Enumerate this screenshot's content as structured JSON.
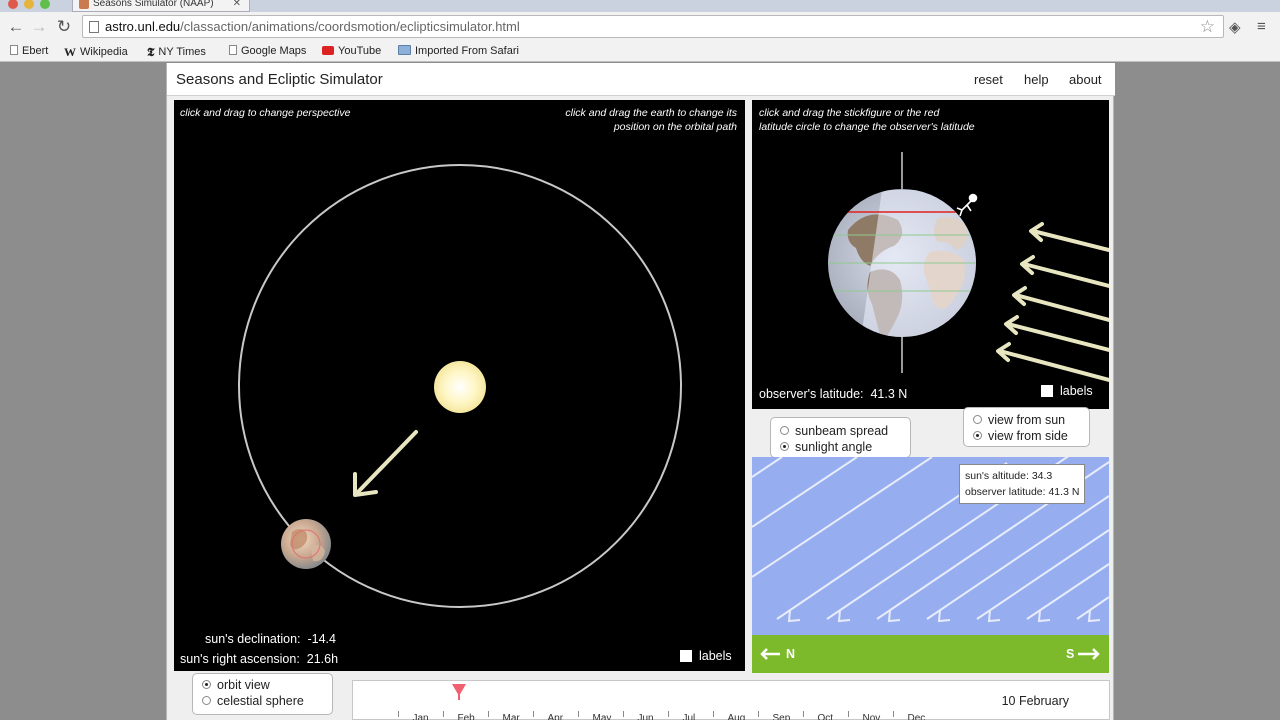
{
  "browser": {
    "tab_title": "Seasons Simulator (NAAP)",
    "url_host": "astro.unl.edu",
    "url_path": "/classaction/animations/coordsmotion/eclipticsimulator.html",
    "bookmarks": [
      {
        "label": "Ebert",
        "icon": "page-icon"
      },
      {
        "label": "Wikipedia",
        "icon": "wikipedia-icon"
      },
      {
        "label": "NY Times",
        "icon": "nytimes-icon"
      },
      {
        "label": "Google Maps",
        "icon": "page-icon"
      },
      {
        "label": "YouTube",
        "icon": "youtube-icon"
      },
      {
        "label": "Imported From Safari",
        "icon": "folder-icon"
      }
    ]
  },
  "sim": {
    "title": "Seasons and Ecliptic Simulator",
    "menu": {
      "reset": "reset",
      "help": "help",
      "about": "about"
    },
    "orbit_panel": {
      "hint_left": "click and drag to change perspective",
      "hint_right_1": "click and drag the earth to change its",
      "hint_right_2": "position on the orbital path",
      "declination_label": "sun's declination:",
      "declination_value": "-14.4",
      "ra_label": "sun's right ascension:",
      "ra_value": "21.6h",
      "labels_checkbox": "labels"
    },
    "earth_panel": {
      "hint_1": "click and drag the stickfigure or the red",
      "hint_2": "latitude circle to change the observer's latitude",
      "latitude_label": "observer's latitude:",
      "latitude_value": "41.3 N",
      "labels_checkbox": "labels"
    },
    "beam_options": {
      "spread": "sunbeam spread",
      "angle": "sunlight angle",
      "selected": "sunlight angle"
    },
    "view_options": {
      "from_sun": "view from sun",
      "from_side": "view from side",
      "selected": "view from side"
    },
    "sunlight_panel": {
      "altitude_label": "sun's altitude:",
      "altitude_value": "34.3",
      "observer_label": "observer latitude:",
      "observer_value": "41.3 N",
      "north": "N",
      "south": "S"
    },
    "view_mode": {
      "orbit": "orbit view",
      "celestial": "celestial sphere",
      "selected": "orbit view"
    },
    "timeline": {
      "date": "10 February",
      "months": [
        "Jan",
        "Feb",
        "Mar",
        "Apr",
        "May",
        "Jun",
        "Jul",
        "Aug",
        "Sep",
        "Oct",
        "Nov",
        "Dec"
      ],
      "day_of_year": 41
    }
  },
  "colors": {
    "sun": "#fff6c6",
    "arrow": "#e8e6c0",
    "sky": "#96aef0",
    "ground": "#7cba2b",
    "latitude_circle": "#e02020"
  }
}
